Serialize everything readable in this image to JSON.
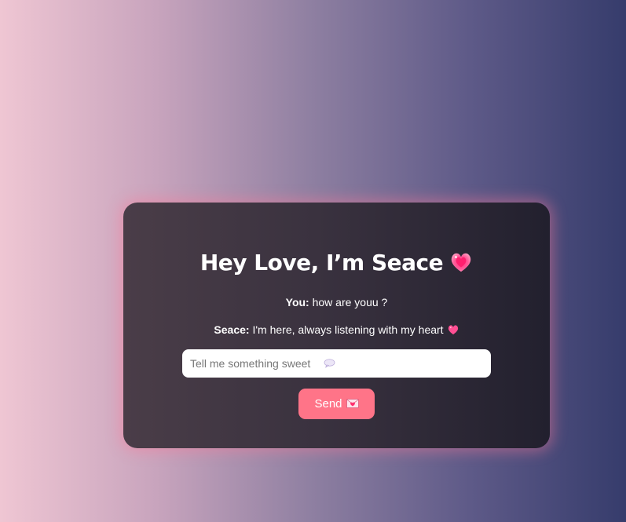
{
  "chat": {
    "title": "Hey Love, I’m Seace",
    "title_icon": "sparkling-heart-icon",
    "messages": [
      {
        "sender": "You:",
        "text": "how are youu ?"
      },
      {
        "sender": "Seace:",
        "text": "I'm here, always listening with my heart",
        "icon": "heart-icon"
      }
    ],
    "input": {
      "placeholder": "Tell me something sweet",
      "value": "",
      "icon": "speech-bubble-icon"
    },
    "send_button": {
      "label": "Send",
      "icon": "love-letter-icon"
    }
  },
  "colors": {
    "accent": "#ff7488",
    "card_bg": "#33303b",
    "bg_left": "#efc6d3",
    "bg_right": "#363c6c"
  }
}
